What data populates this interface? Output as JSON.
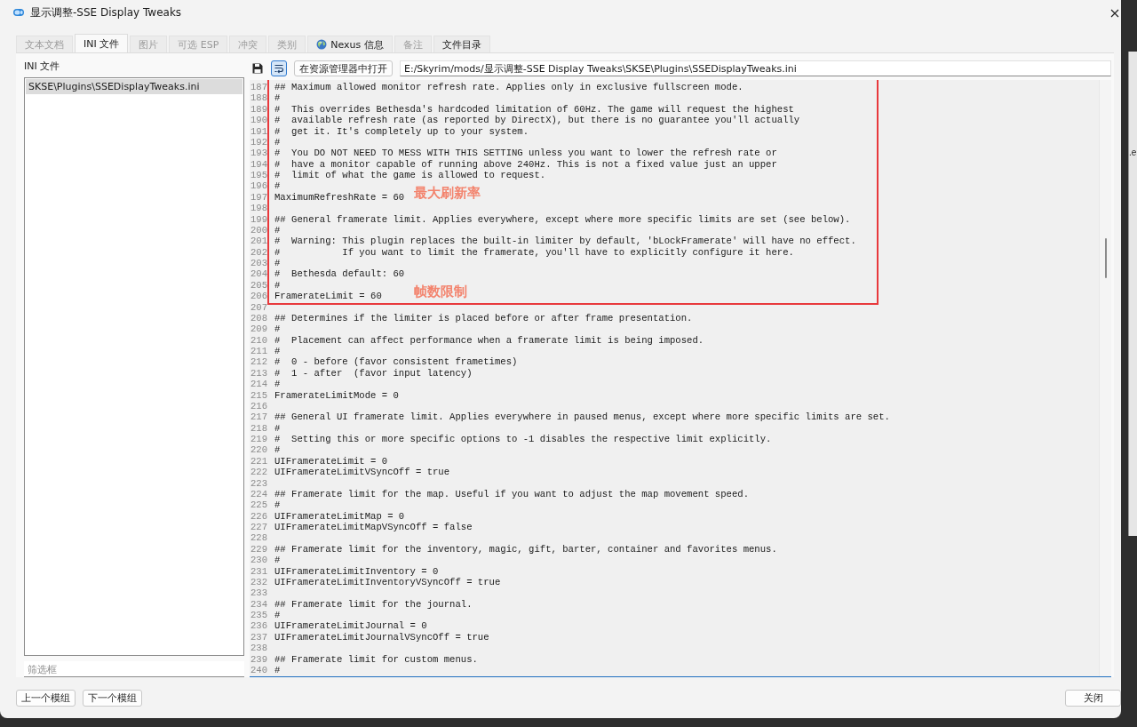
{
  "window": {
    "title": "显示调整-SSE Display Tweaks"
  },
  "tabs": [
    {
      "label": "文本文档",
      "selected": false,
      "disabled": true,
      "kind": "text"
    },
    {
      "label": "INI 文件",
      "selected": true,
      "disabled": false,
      "kind": "text"
    },
    {
      "label": "图片",
      "selected": false,
      "disabled": true,
      "kind": "text"
    },
    {
      "label": "可选 ESP",
      "selected": false,
      "disabled": true,
      "kind": "text"
    },
    {
      "label": "冲突",
      "selected": false,
      "disabled": true,
      "kind": "text"
    },
    {
      "label": "类别",
      "selected": false,
      "disabled": true,
      "kind": "text"
    },
    {
      "label": "Nexus 信息",
      "selected": false,
      "disabled": false,
      "kind": "globe"
    },
    {
      "label": "备注",
      "selected": false,
      "disabled": true,
      "kind": "text"
    },
    {
      "label": "文件目录",
      "selected": false,
      "disabled": false,
      "kind": "text"
    }
  ],
  "ini_panel": {
    "heading": "INI 文件",
    "files": [
      {
        "name": "SKSE\\Plugins\\SSEDisplayTweaks.ini",
        "selected": true
      }
    ],
    "filter": {
      "placeholder": "筛选框"
    }
  },
  "toolbar": {
    "word_wrap_on": true,
    "open_button": "在资源管理器中打开",
    "path": "E:/Skyrim/mods/显示调整-SSE Display Tweaks\\SKSE\\Plugins\\SSEDisplayTweaks.ini"
  },
  "editor": {
    "sections": [
      {
        "highlighted": true,
        "lines": [
          {
            "number": "187",
            "text": "## Maximum allowed monitor refresh rate. Applies only in exclusive fullscreen mode."
          },
          {
            "number": "188",
            "text": "#"
          },
          {
            "number": "189",
            "text": "#  This overrides Bethesda's hardcoded limitation of 60Hz. The game will request the highest"
          },
          {
            "number": "190",
            "text": "#  available refresh rate (as reported by DirectX), but there is no guarantee you'll actually"
          },
          {
            "number": "191",
            "text": "#  get it. It's completely up to your system."
          },
          {
            "number": "192",
            "text": "#"
          },
          {
            "number": "193",
            "text": "#  You DO NOT NEED TO MESS WITH THIS SETTING unless you want to lower the refresh rate or"
          },
          {
            "number": "194",
            "text": "#  have a monitor capable of running above 240Hz. This is not a fixed value just an upper"
          },
          {
            "number": "195",
            "text": "#  limit of what the game is allowed to request."
          },
          {
            "number": "196",
            "text": "#"
          },
          {
            "number": "197",
            "text": "MaximumRefreshRate = 60",
            "note": "最大刷新率"
          },
          {
            "number": "198"
          },
          {
            "number": "199",
            "text": "## General framerate limit. Applies everywhere, except where more specific limits are set (see below)."
          },
          {
            "number": "200",
            "text": "#"
          },
          {
            "number": "201",
            "text": "#  Warning: This plugin replaces the built-in limiter by default, 'bLockFramerate' will have no effect."
          },
          {
            "number": "202",
            "text": "#           If you want to limit the framerate, you'll have to explicitly configure it here."
          },
          {
            "number": "203",
            "text": "#"
          },
          {
            "number": "204",
            "text": "#  Bethesda default: 60"
          },
          {
            "number": "205",
            "text": "#"
          },
          {
            "number": "206",
            "text": "FramerateLimit = 60",
            "note": "帧数限制"
          }
        ]
      },
      {
        "highlighted": false,
        "lines": [
          {
            "number": "207"
          },
          {
            "number": "208",
            "text": "## Determines if the limiter is placed before or after frame presentation."
          },
          {
            "number": "209",
            "text": "#"
          },
          {
            "number": "210",
            "text": "#  Placement can affect performance when a framerate limit is being imposed."
          },
          {
            "number": "211",
            "text": "#"
          },
          {
            "number": "212",
            "text": "#  0 - before (favor consistent frametimes)"
          },
          {
            "number": "213",
            "text": "#  1 - after  (favor input latency)"
          },
          {
            "number": "214",
            "text": "#"
          },
          {
            "number": "215",
            "text": "FramerateLimitMode = 0"
          },
          {
            "number": "216"
          },
          {
            "number": "217",
            "text": "## General UI framerate limit. Applies everywhere in paused menus, except where more specific limits are set."
          },
          {
            "number": "218",
            "text": "#"
          },
          {
            "number": "219",
            "text": "#  Setting this or more specific options to -1 disables the respective limit explicitly."
          },
          {
            "number": "220",
            "text": "#"
          },
          {
            "number": "221",
            "text": "UIFramerateLimit = 0"
          },
          {
            "number": "222",
            "text": "UIFramerateLimitVSyncOff = true"
          },
          {
            "number": "223"
          },
          {
            "number": "224",
            "text": "## Framerate limit for the map. Useful if you want to adjust the map movement speed."
          },
          {
            "number": "225",
            "text": "#"
          },
          {
            "number": "226",
            "text": "UIFramerateLimitMap = 0"
          },
          {
            "number": "227",
            "text": "UIFramerateLimitMapVSyncOff = false"
          },
          {
            "number": "228"
          },
          {
            "number": "229",
            "text": "## Framerate limit for the inventory, magic, gift, barter, container and favorites menus."
          },
          {
            "number": "230",
            "text": "#"
          },
          {
            "number": "231",
            "text": "UIFramerateLimitInventory = 0"
          },
          {
            "number": "232",
            "text": "UIFramerateLimitInventoryVSyncOff = true"
          },
          {
            "number": "233"
          },
          {
            "number": "234",
            "text": "## Framerate limit for the journal."
          },
          {
            "number": "235",
            "text": "#"
          },
          {
            "number": "236",
            "text": "UIFramerateLimitJournal = 0"
          },
          {
            "number": "237",
            "text": "UIFramerateLimitJournalVSyncOff = true"
          },
          {
            "number": "238"
          },
          {
            "number": "239",
            "text": "## Framerate limit for custom menus."
          },
          {
            "number": "240",
            "text": "#"
          }
        ]
      }
    ]
  },
  "footer": {
    "buttons": [
      "上一个模组",
      "下一个模组"
    ],
    "close_button": "关闭"
  },
  "background_window": {
    "text_fragment": ".e"
  }
}
